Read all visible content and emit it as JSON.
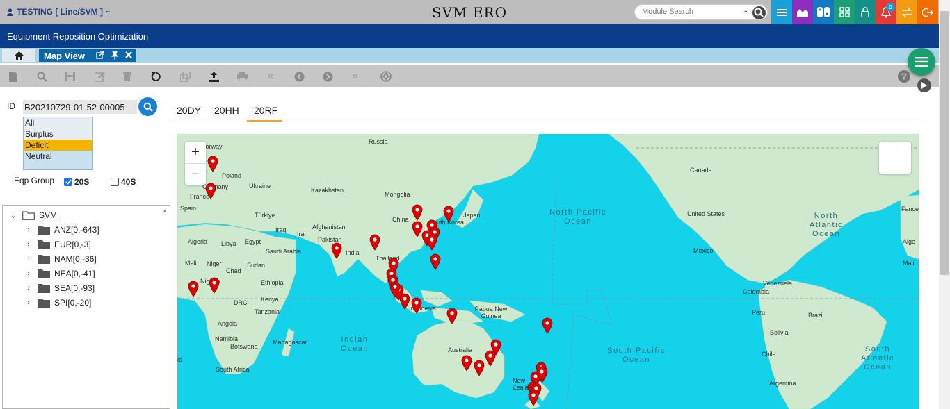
{
  "topbar": {
    "user": "TESTING [ Line/SVM ] ~",
    "title": "SVM ERO",
    "search_placeholder": "Module Search",
    "notification_count": "0",
    "buttons": [
      {
        "name": "menu-icon",
        "color": "#1aa0d8"
      },
      {
        "name": "chart-icon",
        "color": "#8c2fc0"
      },
      {
        "name": "switch-icon",
        "color": "#1678c2"
      },
      {
        "name": "grid-icon",
        "color": "#1d9e74"
      },
      {
        "name": "lock-icon",
        "color": "#13908a"
      },
      {
        "name": "bell-icon",
        "color": "#e53935"
      },
      {
        "name": "transfer-icon",
        "color": "#f39c12"
      },
      {
        "name": "logout-icon",
        "color": "#ef6c00"
      }
    ]
  },
  "header": {
    "title": "Equipment Reposition Optimization"
  },
  "tabs": {
    "active_label": "Map View"
  },
  "toolbar": {
    "tools": [
      "new-icon",
      "search-icon",
      "save-icon",
      "edit-icon",
      "delete-icon",
      "refresh-icon",
      "copy-icon",
      "upload-icon",
      "print-icon",
      "first-icon",
      "prev-icon",
      "next-icon",
      "last-icon",
      "globe-icon"
    ]
  },
  "filters": {
    "id_label": "ID",
    "id_value": "B20210729-01-52-00005",
    "status_options": [
      "All",
      "Surplus",
      "Deficit",
      "Neutral"
    ],
    "status_selected": "Deficit",
    "eqp_group_label": "Eqp Group",
    "eqp_20s": {
      "label": "20S",
      "checked": true
    },
    "eqp_40s": {
      "label": "40S",
      "checked": false
    }
  },
  "tree": {
    "root": "SVM",
    "children": [
      "ANZ[0,-643]",
      "EUR[0,-3]",
      "NAM[0,-36]",
      "NEA[0,-41]",
      "SEA[0,-93]",
      "SPI[0,-20]"
    ]
  },
  "map_tabs": [
    "20DY",
    "20HH",
    "20RF"
  ],
  "map_tab_active": "20RF",
  "map": {
    "zoom_in": "+",
    "zoom_out": "−",
    "labels": [
      "Russia",
      "Norway",
      "Poland",
      "Germany",
      "France",
      "Spain",
      "Ukraine",
      "Kazakhstan",
      "Mongolia",
      "China",
      "Japan",
      "South Korea",
      "Türkiye",
      "Iraq",
      "Iran",
      "Afghanistan",
      "Pakistan",
      "India",
      "Thailand",
      "Indonesia",
      "Papua New Guinea",
      "Australia",
      "New Zealand",
      "Algeria",
      "Libya",
      "Egypt",
      "Saudi Arabia",
      "Mali",
      "Niger",
      "Chad",
      "Sudan",
      "Ethiopia",
      "Nigeria",
      "DRC",
      "Kenya",
      "Tanzania",
      "Angola",
      "Namibia",
      "Botswana",
      "Madagascar",
      "South Africa",
      "Canada",
      "United States",
      "Mexico",
      "Venezuela",
      "Colombia",
      "Peru",
      "Brazil",
      "Bolivia",
      "Chile",
      "Argentina"
    ],
    "oceans": [
      "North Pacific Ocean",
      "South Pacific Ocean",
      "Indian Ocean",
      "North Atlantic Ocean",
      "South Atlantic Ocean"
    ],
    "partial_labels": [
      "Fance",
      "Alge",
      "Mali",
      "ic"
    ],
    "pin_color": "#e00000",
    "ocean_color": "#14d2ea",
    "land_color": "#cfe9cf"
  }
}
